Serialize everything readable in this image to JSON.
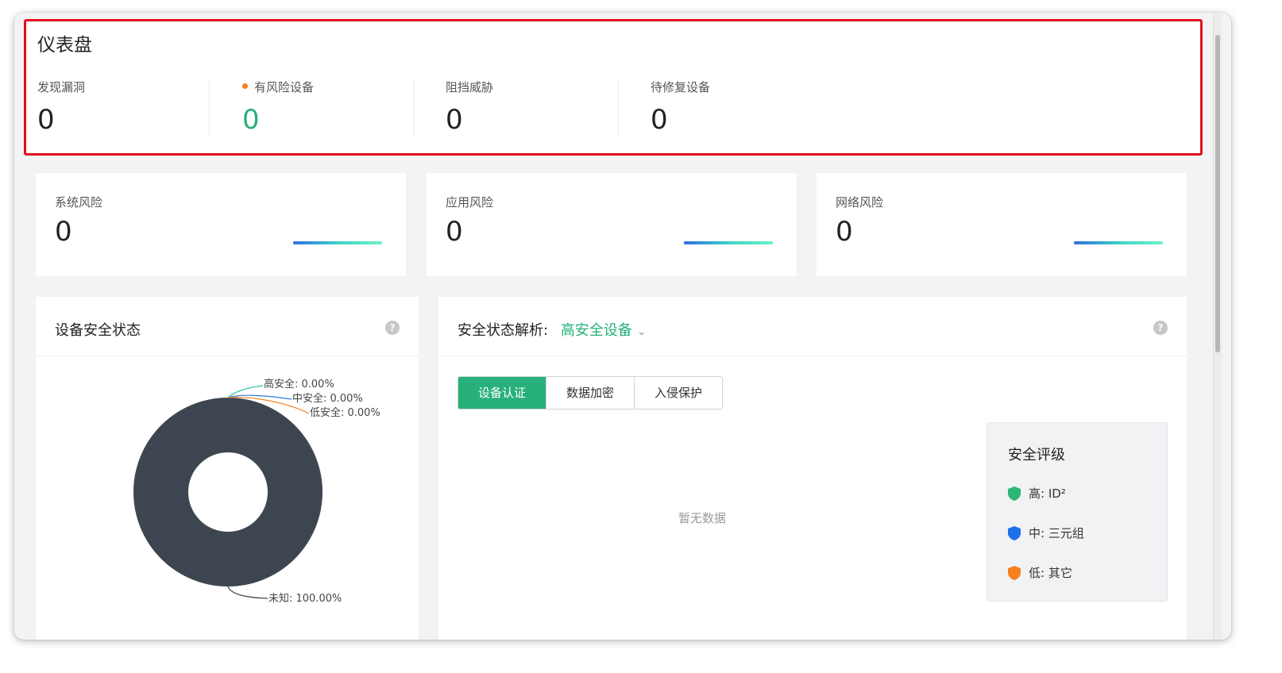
{
  "dashboard": {
    "title": "仪表盘",
    "stats": [
      {
        "label": "发现漏洞",
        "value": "0"
      },
      {
        "label": "有风险设备",
        "value": "0"
      },
      {
        "label": "阻挡威胁",
        "value": "0"
      },
      {
        "label": "待修复设备",
        "value": "0"
      }
    ]
  },
  "risks": [
    {
      "label": "系统风险",
      "value": "0"
    },
    {
      "label": "应用风险",
      "value": "0"
    },
    {
      "label": "网络风险",
      "value": "0"
    }
  ],
  "device_panel": {
    "title": "设备安全状态",
    "help": "?"
  },
  "analysis_panel": {
    "title": "安全状态解析:",
    "selected": "高安全设备",
    "help": "?",
    "tabs": [
      "设备认证",
      "数据加密",
      "入侵保护"
    ],
    "active_tab": 0,
    "empty_text": "暂无数据",
    "legend": {
      "title": "安全评级",
      "items": [
        {
          "text": "高: ID²",
          "color": "#2bb673"
        },
        {
          "text": "中: 三元组",
          "color": "#1d6fe8"
        },
        {
          "text": "低: 其它",
          "color": "#f5821f"
        }
      ]
    }
  },
  "chart_data": {
    "type": "pie",
    "title": "",
    "categories": [
      "高安全",
      "中安全",
      "低安全",
      "未知"
    ],
    "values": [
      0.0,
      0.0,
      0.0,
      100.0
    ],
    "labels": [
      "高安全: 0.00%",
      "中安全: 0.00%",
      "低安全: 0.00%",
      "未知: 100.00%"
    ],
    "colors": [
      "#2ec4a8",
      "#2f7be0",
      "#f5811f",
      "#3d4650"
    ],
    "donut": true
  },
  "colors": {
    "accent": "#27b07a",
    "highlight_border": "#e0101f",
    "risk_dot": "#f5811f",
    "donut_fill": "#3d4650"
  }
}
